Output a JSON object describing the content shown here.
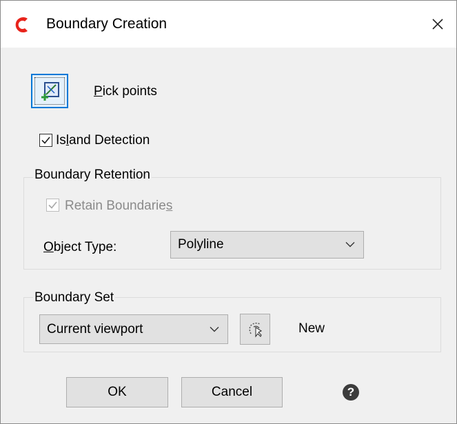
{
  "window": {
    "title": "Boundary Creation",
    "logo_icon": "app-c-logo-icon",
    "close_icon": "close-icon"
  },
  "pick_points": {
    "label_prefix": "",
    "label_access_key": "P",
    "label_rest": "ick points",
    "icon": "pick-points-icon"
  },
  "island_detection": {
    "checked": true,
    "label_pre": "Is",
    "label_access_key": "l",
    "label_post": "and Detection"
  },
  "boundary_retention": {
    "legend": "Boundary Retention",
    "retain": {
      "checked": true,
      "disabled": true,
      "label_pre": "Retain Boundarie",
      "label_access_key": "s"
    },
    "object_type": {
      "label_access_key": "O",
      "label_rest": "bject Type:",
      "selected": "Polyline"
    }
  },
  "boundary_set": {
    "legend": "Boundary Set",
    "selected": "Current viewport",
    "select_icon": "select-objects-icon",
    "new_label": "New"
  },
  "buttons": {
    "ok": "OK",
    "cancel": "Cancel",
    "help": "?"
  },
  "colors": {
    "accent": "#0078d7",
    "logo": "#e8231b",
    "disabled_text": "#8a8a8a"
  }
}
